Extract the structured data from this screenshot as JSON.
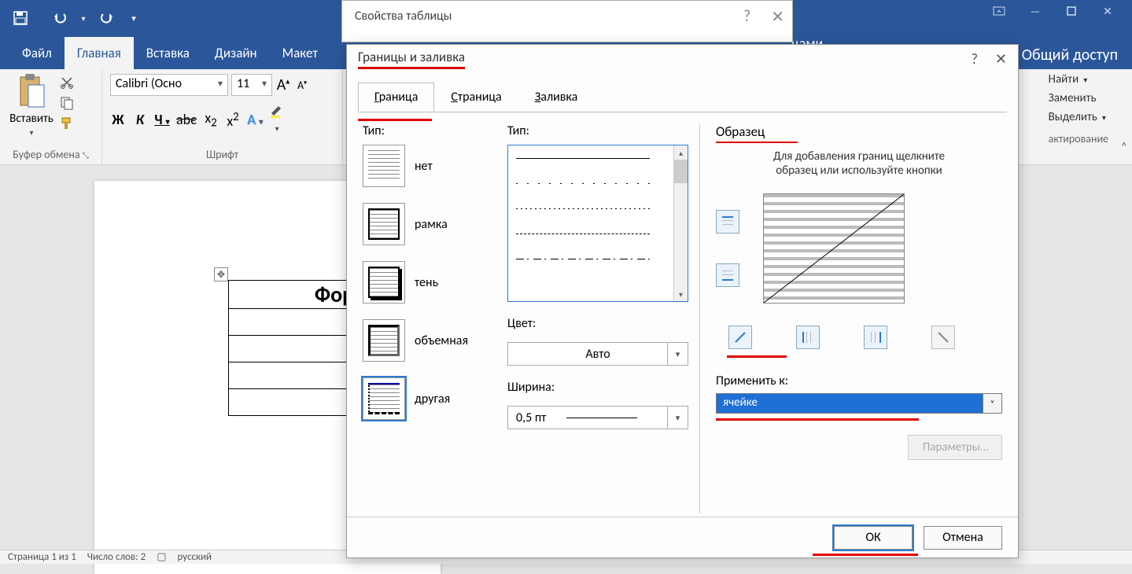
{
  "titlebar": {
    "share": "Общий доступ",
    "tools_fragment": "цами"
  },
  "tabs": {
    "file": "Файл",
    "home": "Главная",
    "insert": "Вставка",
    "design": "Дизайн",
    "layout": "Макет"
  },
  "ribbon": {
    "clipboard_group": "Буфер обмена",
    "paste": "Вставить",
    "font_group": "Шрифт",
    "font_name": "Calibri (Осно",
    "font_size": "11",
    "editing_group": "актирование",
    "find": "Найти",
    "replace": "Заменить",
    "select": "Выделить"
  },
  "doc": {
    "table_heading": "Фор"
  },
  "dlg_under": {
    "title": "Свойства таблицы"
  },
  "dlg": {
    "title": "Границы и заливка",
    "tab_border": "раница",
    "tab_border_u": "Г",
    "tab_page": "траница",
    "tab_page_u": "С",
    "tab_fill": "аливка",
    "tab_fill_u": "З",
    "setting_label": "Тип:",
    "style_label": "Тип:",
    "color_label": "Цвет:",
    "color_auto": "Авто",
    "width_label": "Ширина:",
    "width_val": "0,5 пт",
    "preview_label": "Образец",
    "preview_hint1": "Для добавления границ щелкните",
    "preview_hint2": "образец или используйте кнопки",
    "apply_label": "Применить к:",
    "apply_value": "ячейке",
    "params": "Параметры...",
    "ok": "ОК",
    "cancel": "Отмена",
    "settings": {
      "none": "нет",
      "box": "рамка",
      "shadow": "тень",
      "threeD": "объемная",
      "custom": "другая"
    }
  },
  "status": {
    "page": "Страница 1 из 1",
    "words": "Число слов: 2",
    "lang": "русский"
  }
}
